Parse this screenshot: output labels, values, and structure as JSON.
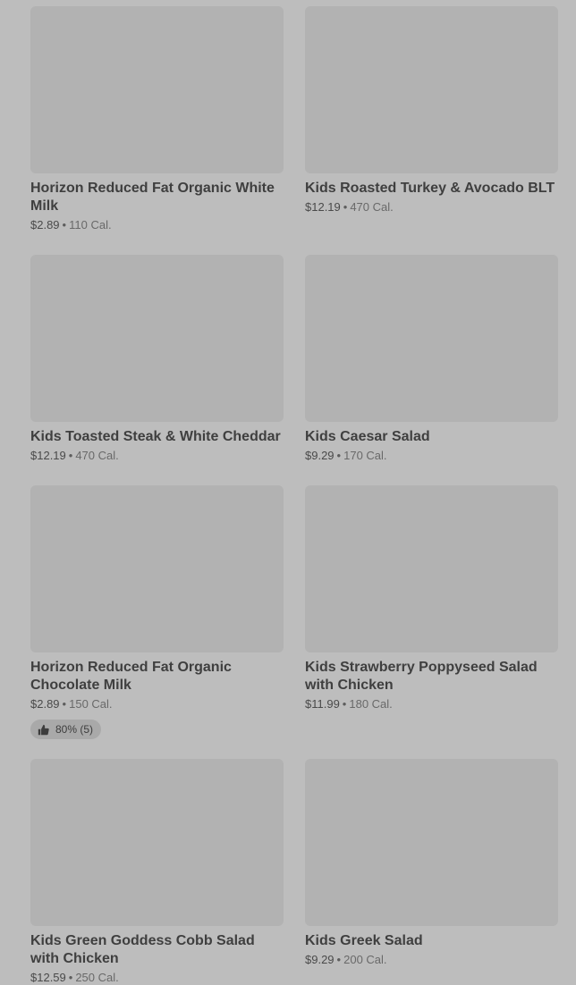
{
  "items": [
    {
      "name": "Horizon Reduced Fat Organic White Milk",
      "price": "$2.89",
      "calories": "110 Cal."
    },
    {
      "name": "Kids Roasted Turkey & Avocado BLT",
      "price": "$12.19",
      "calories": "470 Cal."
    },
    {
      "name": "Kids Toasted Steak & White Cheddar",
      "price": "$12.19",
      "calories": "470 Cal."
    },
    {
      "name": "Kids Caesar Salad",
      "price": "$9.29",
      "calories": "170 Cal."
    },
    {
      "name": "Horizon Reduced Fat Organic Chocolate Milk",
      "price": "$2.89",
      "calories": "150 Cal.",
      "rating": "80% (5)",
      "rating_icon": "thumbs-up-icon"
    },
    {
      "name": "Kids Strawberry Poppyseed Salad with Chicken",
      "price": "$11.99",
      "calories": "180 Cal."
    },
    {
      "name": "Kids Green Goddess Cobb Salad with Chicken",
      "price": "$12.59",
      "calories": "250 Cal."
    },
    {
      "name": "Kids Greek Salad",
      "price": "$9.29",
      "calories": "200 Cal."
    }
  ],
  "separator": "•",
  "colors": {
    "background": "#bdbdbd",
    "thumbnail": "#b2b2b2",
    "badge": "#a9a9a9"
  }
}
